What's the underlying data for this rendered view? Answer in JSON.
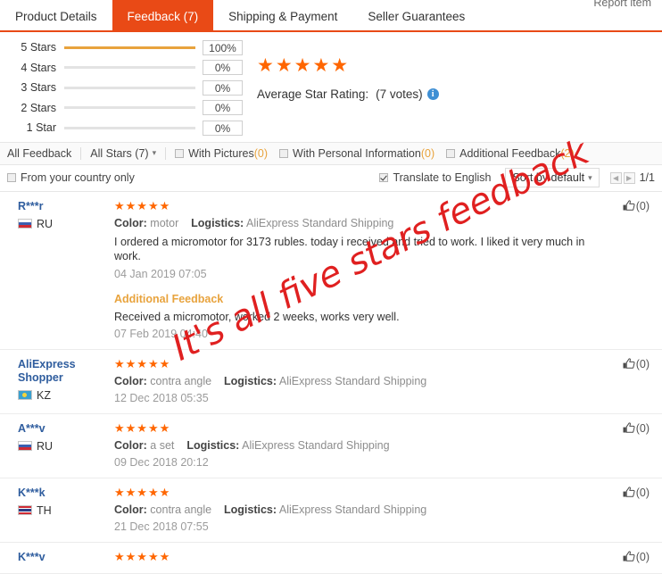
{
  "tabs": [
    {
      "label": "Product Details",
      "active": false
    },
    {
      "label": "Feedback (7)",
      "active": true
    },
    {
      "label": "Shipping & Payment",
      "active": false
    },
    {
      "label": "Seller Guarantees",
      "active": false
    }
  ],
  "report_item": "Report item",
  "rating_summary": {
    "rows": [
      {
        "label": "5 Stars",
        "percent": "100%",
        "fill": 100
      },
      {
        "label": "4 Stars",
        "percent": "0%",
        "fill": 0
      },
      {
        "label": "3 Stars",
        "percent": "0%",
        "fill": 0
      },
      {
        "label": "2 Stars",
        "percent": "0%",
        "fill": 0
      },
      {
        "label": "1 Star",
        "percent": "0%",
        "fill": 0
      }
    ],
    "stars": "★★★★★",
    "avg_label": "Average Star Rating:",
    "votes": "(7 votes)",
    "info_glyph": "i"
  },
  "filters": {
    "all_feedback": "All Feedback",
    "all_stars": "All Stars (7)",
    "with_pictures": "With Pictures",
    "with_pictures_count": "(0)",
    "with_personal_info": "With Personal Information",
    "with_personal_info_count": "(0)",
    "additional_feedback": "Additional Feedback",
    "additional_feedback_count": "(2)",
    "from_country": "From your country only",
    "translate": "Translate to English",
    "sort": "Sort by default",
    "page_prev": "◀",
    "page_next": "▶",
    "page_label": "1/1"
  },
  "reviews": [
    {
      "name": "R***r",
      "country": "RU",
      "flag": "flag-ru",
      "stars": "★★★★★",
      "color_label": "Color:",
      "color_value": "motor",
      "logistics_label": "Logistics:",
      "logistics_value": "AliExpress Standard Shipping",
      "text": "I ordered a micromotor for 3173 rubles. today i received and tried to work. I liked it very much in work.",
      "date": "04 Jan 2019 07:05",
      "additional_title": "Additional Feedback",
      "additional_text": "Received a micromotor, worked 2 weeks, works very well.",
      "additional_date": "07 Feb 2019 04:40",
      "likes": "(0)"
    },
    {
      "name": "AliExpress Shopper",
      "country": "KZ",
      "flag": "flag-kz",
      "stars": "★★★★★",
      "color_label": "Color:",
      "color_value": "contra angle",
      "logistics_label": "Logistics:",
      "logistics_value": "AliExpress Standard Shipping",
      "text": "",
      "date": "12 Dec 2018 05:35",
      "likes": "(0)"
    },
    {
      "name": "A***v",
      "country": "RU",
      "flag": "flag-ru",
      "stars": "★★★★★",
      "color_label": "Color:",
      "color_value": "a set",
      "logistics_label": "Logistics:",
      "logistics_value": "AliExpress Standard Shipping",
      "text": "",
      "date": "09 Dec 2018 20:12",
      "likes": "(0)"
    },
    {
      "name": "K***k",
      "country": "TH",
      "flag": "flag-th",
      "stars": "★★★★★",
      "color_label": "Color:",
      "color_value": "contra angle",
      "logistics_label": "Logistics:",
      "logistics_value": "AliExpress Standard Shipping",
      "text": "",
      "date": "21 Dec 2018 07:55",
      "likes": "(0)"
    },
    {
      "name": "K***v",
      "country": "",
      "flag": "",
      "stars": "★★★★★",
      "color_label": "",
      "color_value": "",
      "logistics_label": "",
      "logistics_value": "",
      "text": "",
      "date": "",
      "likes": "(0)"
    }
  ],
  "watermark": "It's all five stars feedback",
  "colors": {
    "accent": "#e94a16",
    "star": "#ff6600",
    "bar": "#e8a33d",
    "link": "#2f5d9e",
    "watermark": "#e02020"
  }
}
